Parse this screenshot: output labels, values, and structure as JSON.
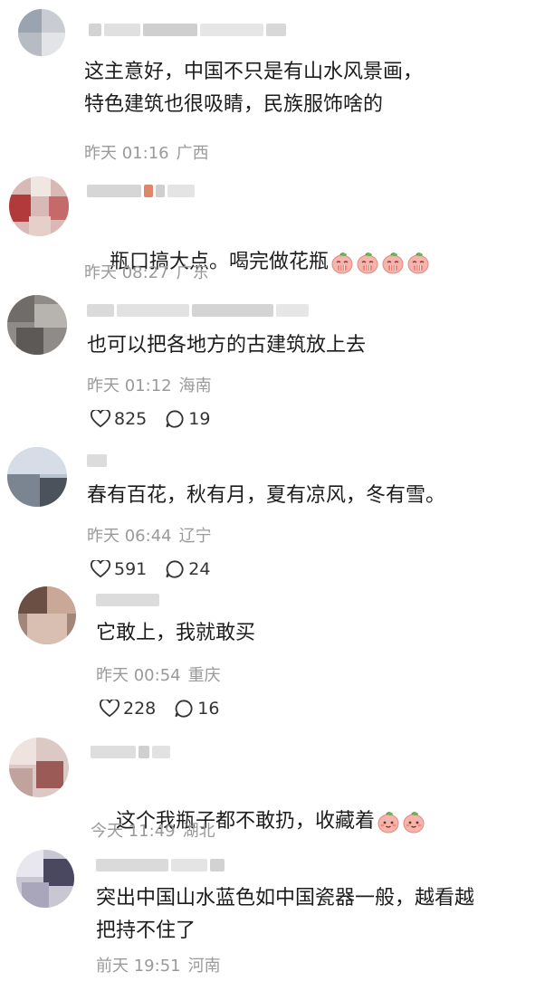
{
  "comments": [
    {
      "text": "这主意好，中国不只是有山水风景画，\n特色建筑也很吸睛，民族服饰啥的",
      "time": "昨天 01:16",
      "location": "广西"
    },
    {
      "text": "瓶口搞大点。喝完做花瓶",
      "time": "昨天 08:27",
      "location": "广东",
      "emojis": [
        "peach-pleading-emoji",
        "peach-pleading-emoji",
        "peach-pleading-emoji",
        "peach-pleading-emoji"
      ]
    },
    {
      "text": "也可以把各地方的古建筑放上去",
      "time": "昨天 01:12",
      "location": "海南",
      "likes": "825",
      "replies": "19"
    },
    {
      "text": "春有百花，秋有月，夏有凉风，冬有雪。",
      "time": "昨天 06:44",
      "location": "辽宁",
      "likes": "591",
      "replies": "24"
    },
    {
      "text": "它敢上，我就敢买",
      "time": "昨天 00:54",
      "location": "重庆",
      "likes": "228",
      "replies": "16"
    },
    {
      "text": "这个我瓶子都不敢扔，收藏着",
      "time": "今天 11:49",
      "location": "湖北",
      "emojis": [
        "peach-shy-emoji",
        "peach-shy-emoji"
      ]
    },
    {
      "text": "突出中国山水蓝色如中国瓷器一般，越看越\n把持不住了",
      "time": "前天 19:51",
      "location": "河南"
    }
  ],
  "icons": {
    "like": "heart-icon",
    "reply": "speech-bubble-icon"
  },
  "colors": {
    "meta": "#9a9a9a",
    "text": "#1c1c1c",
    "blur": "#cfcfcf"
  }
}
